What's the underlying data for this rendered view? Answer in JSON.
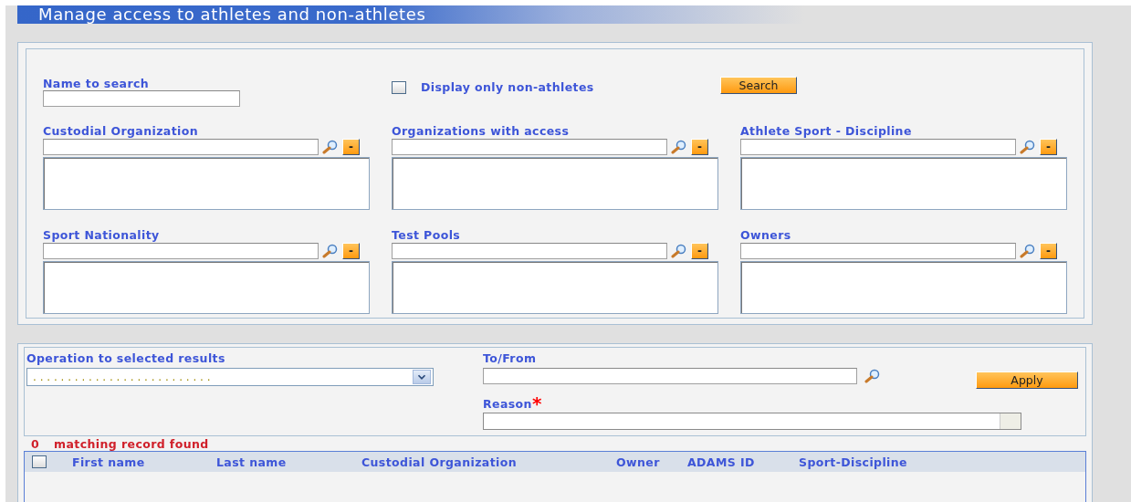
{
  "title": "Manage access to athletes and non-athletes",
  "filters": {
    "name_search": {
      "label": "Name to search"
    },
    "non_athletes_only": {
      "label": "Display only non-athletes",
      "checked": false
    },
    "search_button": "Search",
    "lookups": [
      {
        "label": "Custodial Organization",
        "clear_button": "-"
      },
      {
        "label": "Organizations with access",
        "clear_button": "-"
      },
      {
        "label": "Athlete Sport - Discipline",
        "clear_button": "-"
      },
      {
        "label": "Sport Nationality",
        "clear_button": "-"
      },
      {
        "label": "Test Pools",
        "clear_button": "-"
      },
      {
        "label": "Owners",
        "clear_button": "-"
      }
    ]
  },
  "operations": {
    "operation": {
      "label": "Operation to selected results",
      "value": ". . . . . . . . . . . . . . . . . . . . . . . . . ."
    },
    "to_from": {
      "label": "To/From"
    },
    "apply_button": "Apply",
    "reason": {
      "label": "Reason",
      "required_mark": "*"
    }
  },
  "results": {
    "count": "0",
    "message": "matching record found",
    "all_selected": false,
    "columns": [
      "First name",
      "Last name",
      "Custodial Organization",
      "Owner",
      "ADAMS ID",
      "Sport-Discipline"
    ]
  }
}
